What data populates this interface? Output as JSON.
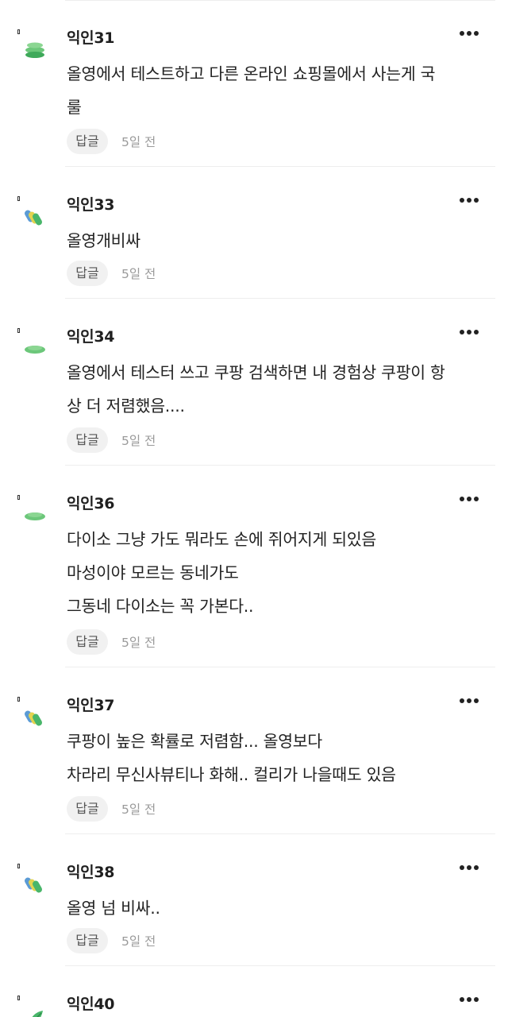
{
  "comments": [
    {
      "author": "익인31",
      "lines": [
        "올영에서 테스트하고 다른 온라인 쇼핑몰에서 사는게 국",
        "룰"
      ],
      "reply_label": "답글",
      "time": "5일 전",
      "avatar_icon": "green-stacked-discs-icon"
    },
    {
      "author": "익인33",
      "lines": [
        "올영개비싸"
      ],
      "reply_label": "답글",
      "time": "5일 전",
      "avatar_icon": "tilted-pills-icon"
    },
    {
      "author": "익인34",
      "lines": [
        "올영에서 테스터 쓰고 쿠팡 검색하면 내 경험상 쿠팡이 항",
        "상 더 저렴했음...."
      ],
      "reply_label": "답글",
      "time": "5일 전",
      "avatar_icon": "green-disc-icon"
    },
    {
      "author": "익인36",
      "lines": [
        "다이소 그냥 가도 뭐라도 손에 쥐어지게 되있음",
        "마성이야 모르는 동네가도",
        "그동네 다이소는 꼭 가본다.."
      ],
      "reply_label": "답글",
      "time": "5일 전",
      "avatar_icon": "green-disc-icon"
    },
    {
      "author": "익인37",
      "lines": [
        "쿠팡이 높은 확률로 저렴함... 올영보다",
        "차라리 무신사뷰티나 화해.. 컬리가 나을때도 있음"
      ],
      "reply_label": "답글",
      "time": "5일 전",
      "avatar_icon": "tilted-pills-icon"
    },
    {
      "author": "익인38",
      "lines": [
        "올영 넘 비싸.."
      ],
      "reply_label": "답글",
      "time": "5일 전",
      "avatar_icon": "tilted-pills-icon"
    },
    {
      "author": "익인40",
      "lines": [],
      "reply_label": "",
      "time": "",
      "avatar_icon": "green-leaf-icon"
    }
  ],
  "colors": {
    "avatar_green": "#6cc77a",
    "avatar_teal": "#49b6b0",
    "avatar_yellow": "#e3d34f",
    "avatar_blue": "#5b9bd5",
    "divider": "#eeeeee",
    "reply_bg": "#f1f1f1",
    "time_text": "#9a9a9a"
  }
}
